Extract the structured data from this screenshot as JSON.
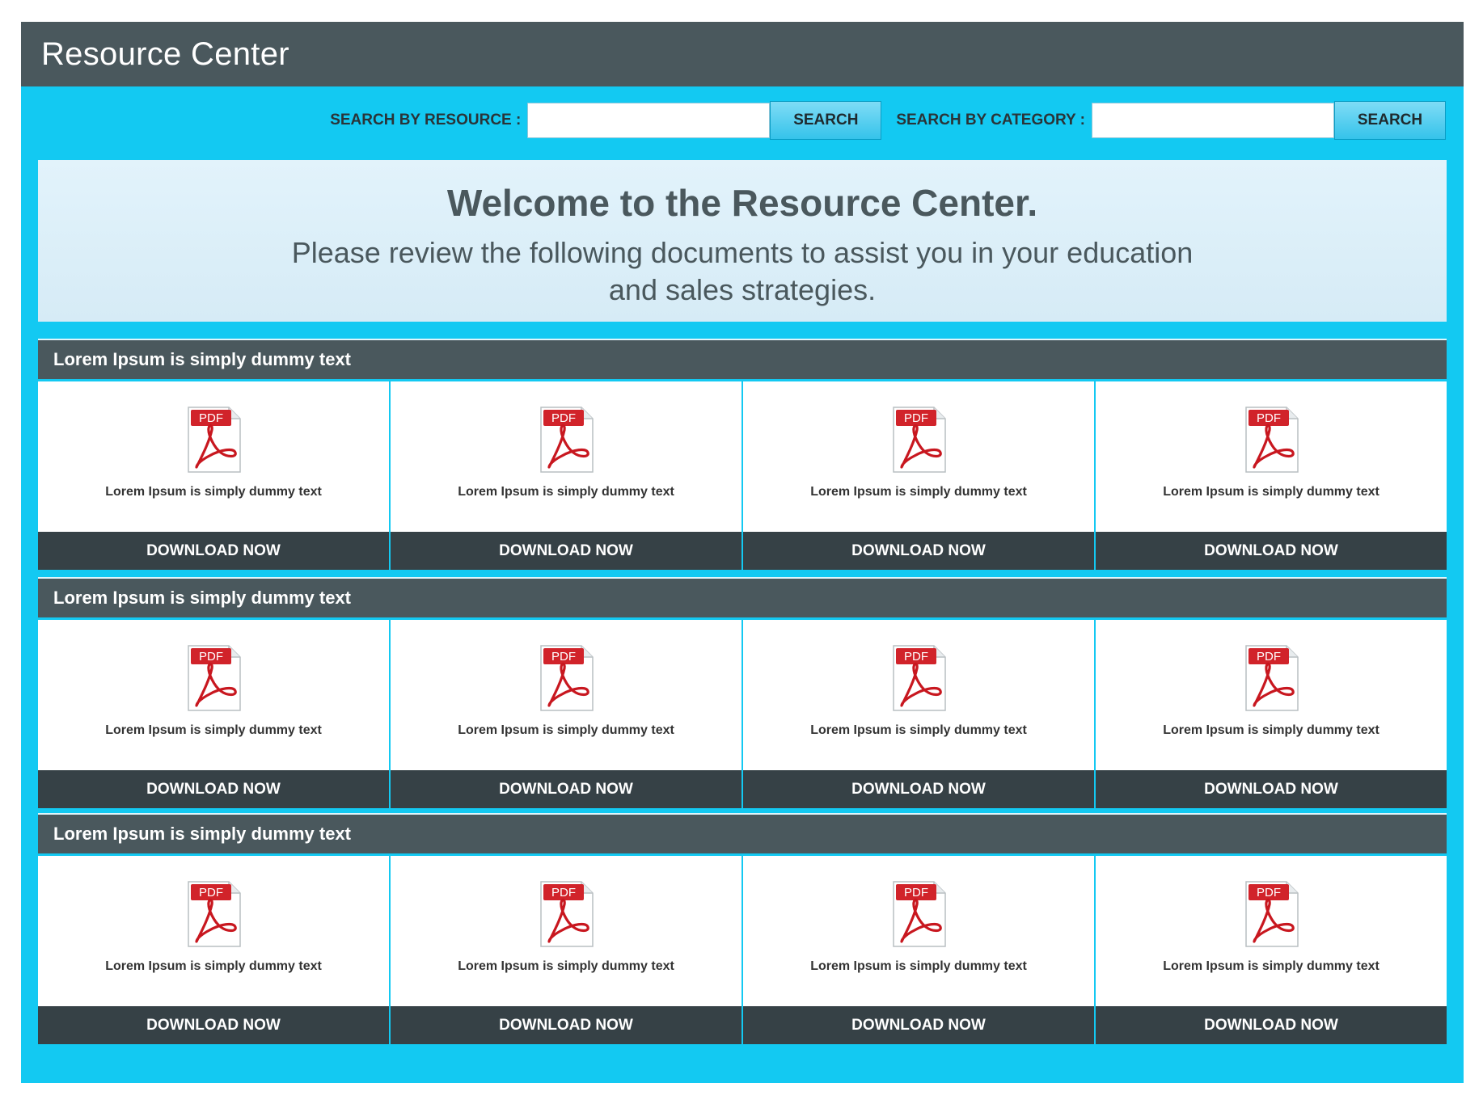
{
  "app": {
    "title": "Resource Center"
  },
  "search": {
    "resource_label": "SEARCH BY RESOURCE :",
    "resource_value": "",
    "resource_button": "SEARCH",
    "category_label": "SEARCH BY CATEGORY :",
    "category_value": "",
    "category_button": "SEARCH"
  },
  "welcome": {
    "heading": "Welcome to the Resource Center.",
    "text": "Please review the following documents to assist you in your education and sales strategies."
  },
  "sections": [
    {
      "title": "Lorem Ipsum is simply dummy text",
      "cards": [
        {
          "icon": "pdf-file-icon",
          "icon_badge": "PDF",
          "label": "Lorem Ipsum is simply dummy text",
          "button": "DOWNLOAD NOW"
        },
        {
          "icon": "pdf-file-icon",
          "icon_badge": "PDF",
          "label": "Lorem Ipsum is simply dummy text",
          "button": "DOWNLOAD NOW"
        },
        {
          "icon": "pdf-file-icon",
          "icon_badge": "PDF",
          "label": "Lorem Ipsum is simply dummy text",
          "button": "DOWNLOAD NOW"
        },
        {
          "icon": "pdf-file-icon",
          "icon_badge": "PDF",
          "label": "Lorem Ipsum is simply dummy text",
          "button": "DOWNLOAD NOW"
        }
      ]
    },
    {
      "title": "Lorem Ipsum is simply dummy text",
      "cards": [
        {
          "icon": "pdf-file-icon",
          "icon_badge": "PDF",
          "label": "Lorem Ipsum is simply dummy text",
          "button": "DOWNLOAD NOW"
        },
        {
          "icon": "pdf-file-icon",
          "icon_badge": "PDF",
          "label": "Lorem Ipsum is simply dummy text",
          "button": "DOWNLOAD NOW"
        },
        {
          "icon": "pdf-file-icon",
          "icon_badge": "PDF",
          "label": "Lorem Ipsum is simply dummy text",
          "button": "DOWNLOAD NOW"
        },
        {
          "icon": "pdf-file-icon",
          "icon_badge": "PDF",
          "label": "Lorem Ipsum is simply dummy text",
          "button": "DOWNLOAD NOW"
        }
      ]
    },
    {
      "title": "Lorem Ipsum is simply dummy text",
      "cards": [
        {
          "icon": "pdf-file-icon",
          "icon_badge": "PDF",
          "label": "Lorem Ipsum is simply dummy text",
          "button": "DOWNLOAD NOW"
        },
        {
          "icon": "pdf-file-icon",
          "icon_badge": "PDF",
          "label": "Lorem Ipsum is simply dummy text",
          "button": "DOWNLOAD NOW"
        },
        {
          "icon": "pdf-file-icon",
          "icon_badge": "PDF",
          "label": "Lorem Ipsum is simply dummy text",
          "button": "DOWNLOAD NOW"
        },
        {
          "icon": "pdf-file-icon",
          "icon_badge": "PDF",
          "label": "Lorem Ipsum is simply dummy text",
          "button": "DOWNLOAD NOW"
        }
      ]
    }
  ],
  "colors": {
    "background_accent": "#13c9f2",
    "header_bar": "#4a585d",
    "download_button": "#364146",
    "pdf_red": "#d1232a"
  }
}
